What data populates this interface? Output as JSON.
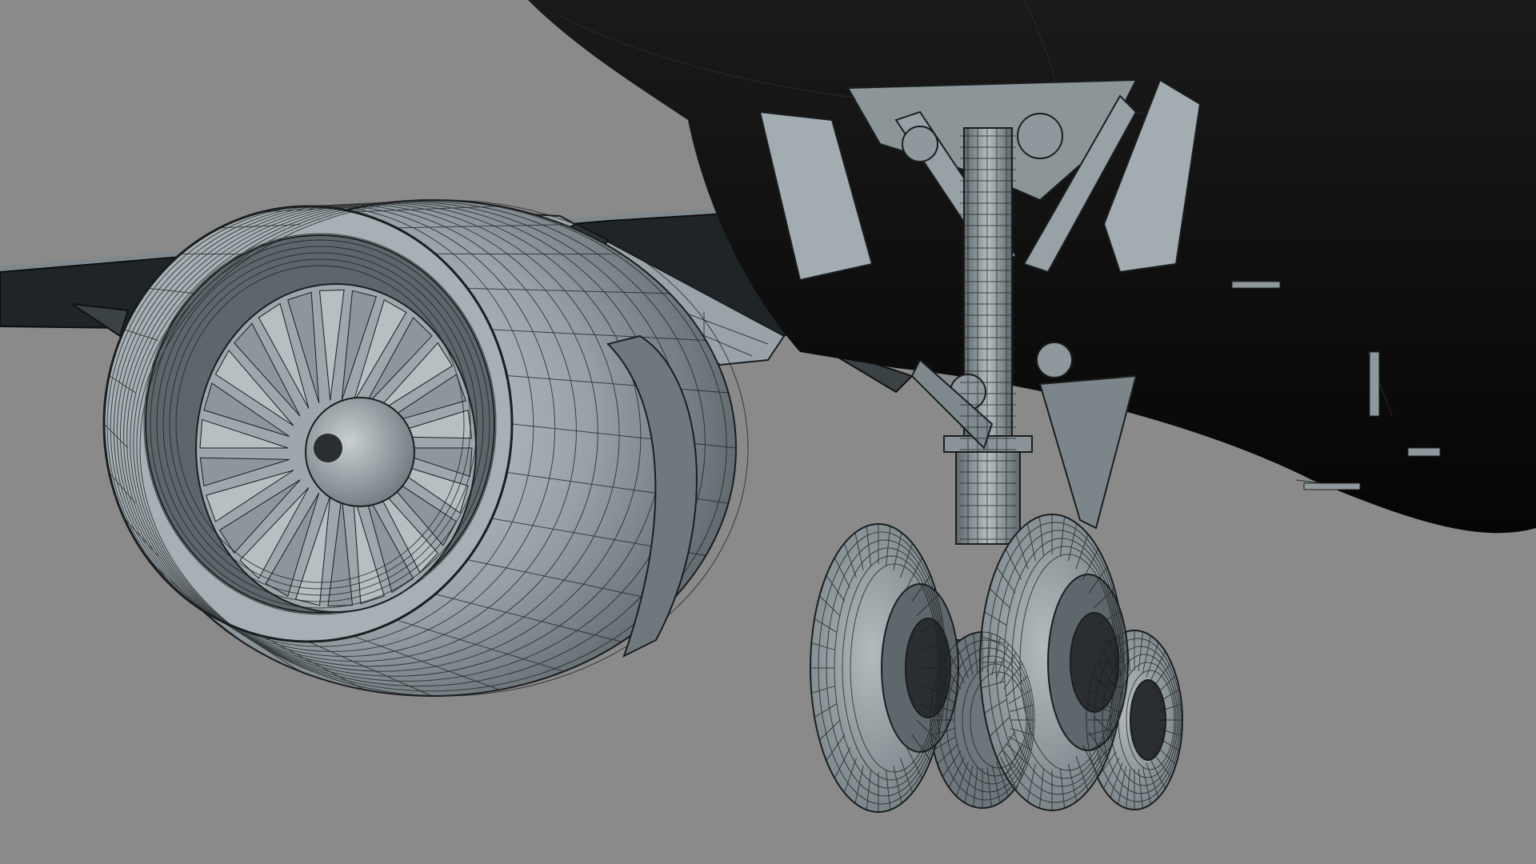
{
  "viewport": {
    "background_color": "#8a8a8a",
    "shading": "wireframe-on-shaded",
    "subject": [
      "fuselage-underside",
      "wing",
      "turbofan-engine",
      "main-landing-gear"
    ]
  },
  "colors": {
    "fuselage": "#0b0b0b",
    "metal_light": "#b8c2c6",
    "metal_mid": "#8f999d",
    "metal_dark": "#5b6468",
    "wire": "#1a1e20",
    "tire": "#9aa3a7",
    "hub_dark": "#2a2e30"
  }
}
